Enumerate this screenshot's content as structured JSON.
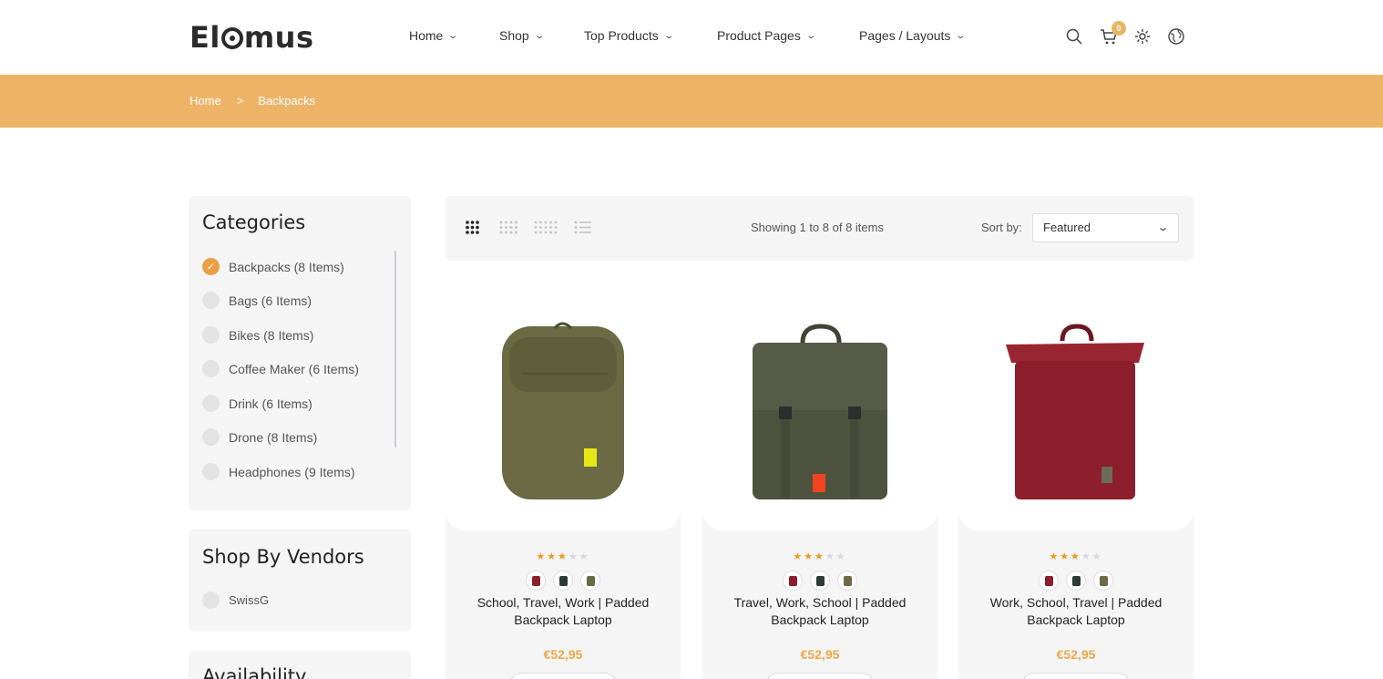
{
  "brand": {
    "name_pre": "El",
    "name_post": "mus"
  },
  "nav": [
    {
      "label": "Home"
    },
    {
      "label": "Shop"
    },
    {
      "label": "Top Products"
    },
    {
      "label": "Product Pages"
    },
    {
      "label": "Pages / Layouts"
    }
  ],
  "header_icons": {
    "cart_count": "0",
    "icons": [
      "search-icon",
      "cart-icon",
      "settings-icon",
      "globe-icon"
    ]
  },
  "breadcrumb": {
    "home": "Home",
    "separator": ">",
    "current": "Backpacks"
  },
  "sidebar": {
    "categories_title": "Categories",
    "categories": [
      {
        "label": "Backpacks (8 Items)",
        "checked": true
      },
      {
        "label": "Bags (6 Items)",
        "checked": false
      },
      {
        "label": "Bikes (8 Items)",
        "checked": false
      },
      {
        "label": "Coffee Maker (6 Items)",
        "checked": false
      },
      {
        "label": "Drink (6 Items)",
        "checked": false
      },
      {
        "label": "Drone (8 Items)",
        "checked": false
      },
      {
        "label": "Headphones (9 Items)",
        "checked": false
      }
    ],
    "vendors_title": "Shop By Vendors",
    "vendors": [
      {
        "label": "SwissG"
      }
    ],
    "availability_title": "Availability"
  },
  "toolbar": {
    "showing": "Showing 1 to 8 of 8 items",
    "sort_label": "Sort by:",
    "sort_value": "Featured",
    "views": [
      "grid-3-icon",
      "grid-4-icon",
      "grid-5-icon",
      "list-icon"
    ]
  },
  "products": [
    {
      "title": "School, Travel, Work | Padded Backpack Laptop",
      "price": "€52,95",
      "rating": 3,
      "max_rating": 5,
      "color": "#6b6a45"
    },
    {
      "title": "Travel, Work, School | Padded Backpack Laptop",
      "price": "€52,95",
      "rating": 3,
      "max_rating": 5,
      "color": "#4e5340"
    },
    {
      "title": "Work, School, Travel | Padded Backpack Laptop",
      "price": "€52,95",
      "rating": 3,
      "max_rating": 5,
      "color": "#8c1f2b"
    }
  ],
  "swatch_colors": [
    "#8c1f2b",
    "#2e3a36",
    "#6b6a45"
  ],
  "colors": {
    "accent": "#edb468",
    "price": "#eda84b",
    "star": "#ef9a1f"
  }
}
